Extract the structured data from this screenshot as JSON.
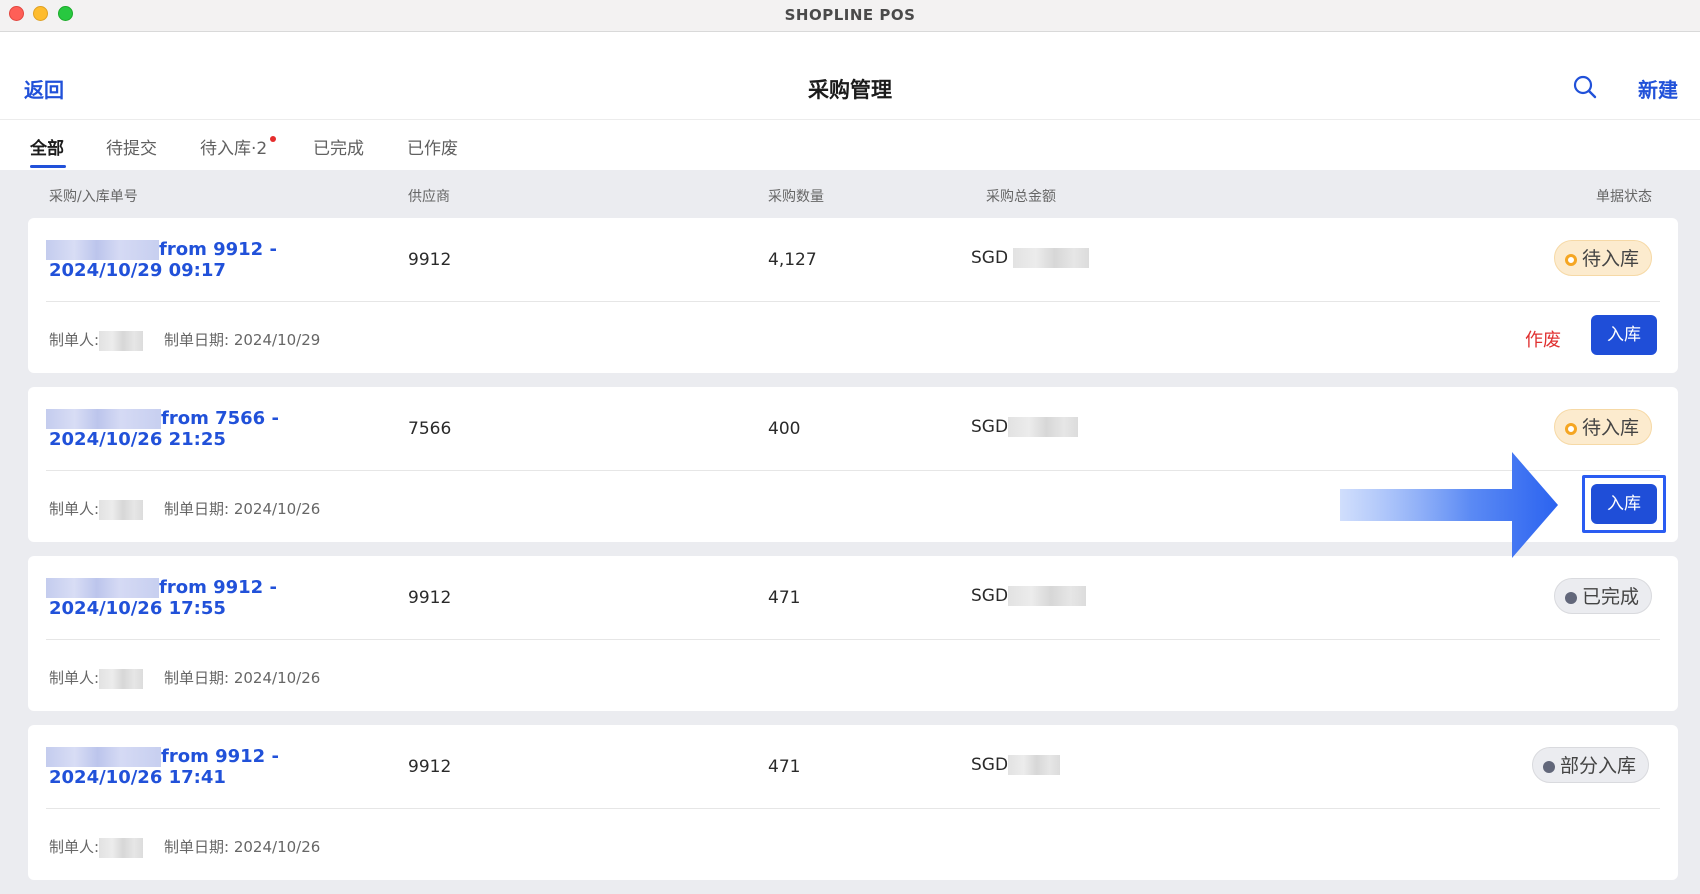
{
  "window": {
    "title": "SHOPLINE POS"
  },
  "header": {
    "back_label": "返回",
    "title": "采购管理",
    "new_label": "新建",
    "search_icon": "search-icon"
  },
  "tabs": [
    {
      "label": "全部",
      "active": true
    },
    {
      "label": "待提交"
    },
    {
      "label": "待入库·2",
      "has_dot": true
    },
    {
      "label": "已完成"
    },
    {
      "label": "已作废"
    }
  ],
  "columns": {
    "order_no": "采购/入库单号",
    "supplier": "供应商",
    "quantity": "采购数量",
    "total": "采购总金额",
    "status": "单据状态"
  },
  "labels": {
    "creator": "制单人:",
    "created_date": "制单日期:",
    "void": "作废",
    "stock_in": "入库",
    "currency": "SGD"
  },
  "orders": [
    {
      "order_from": "from 9912 -",
      "order_time": "2024/10/29 09:17",
      "supplier": "9912",
      "quantity": "4,127",
      "status": "待入库",
      "created_date": "2024/10/29"
    },
    {
      "order_from": "from 7566 -",
      "order_time": "2024/10/26 21:25",
      "supplier": "7566",
      "quantity": "400",
      "status": "待入库",
      "created_date": "2024/10/26"
    },
    {
      "order_from": "from 9912 -",
      "order_time": "2024/10/26 17:55",
      "supplier": "9912",
      "quantity": "471",
      "status": "已完成",
      "created_date": "2024/10/26"
    },
    {
      "order_from": "from 9912 -",
      "order_time": "2024/10/26 17:41",
      "supplier": "9912",
      "quantity": "471",
      "status": "部分入库",
      "created_date": "2024/10/26"
    }
  ],
  "colors": {
    "accent": "#1f4ed8",
    "link": "#2151d9",
    "danger": "#e03131",
    "pending_bg": "#fcebce",
    "pending_dot": "#f5a623"
  }
}
